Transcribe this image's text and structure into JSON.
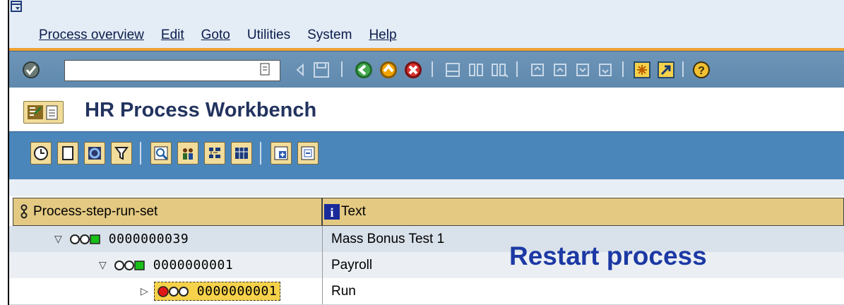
{
  "menu": {
    "items": [
      "Process overview",
      "Edit",
      "Goto",
      "Utilities",
      "System",
      "Help"
    ]
  },
  "toolbar": {
    "command_field_value": "",
    "icons": [
      "enter-icon",
      "dropdown-icon",
      "back-arrow-icon",
      "save-icon",
      "back-icon",
      "exit-icon",
      "cancel-icon",
      "print-icon",
      "find-icon",
      "find-next-icon",
      "first-page-icon",
      "prev-page-icon",
      "next-page-icon",
      "last-page-icon",
      "new-session-icon",
      "shortcut-icon",
      "help-icon"
    ]
  },
  "page": {
    "title": "HR Process Workbench"
  },
  "app_toolbar": {
    "icons": [
      "execute-icon",
      "new-icon",
      "refresh-icon",
      "filter-icon",
      "detail-icon",
      "people-icon",
      "hierarchy-icon",
      "layout-icon",
      "expand-icon",
      "collapse-icon"
    ]
  },
  "table": {
    "headers": [
      "Process-step-run-set",
      "Text"
    ],
    "rows": [
      {
        "level": 0,
        "expander": "▽",
        "status": "green",
        "id": "0000000039",
        "text": "Mass Bonus Test 1"
      },
      {
        "level": 1,
        "expander": "▽",
        "status": "green",
        "id": "0000000001",
        "text": "Payroll"
      },
      {
        "level": 2,
        "expander": "▷",
        "status": "red",
        "id": "0000000001",
        "text": "Run"
      }
    ]
  },
  "callout": "Restart process",
  "colors": {
    "menu_bg": "#e4ecf6",
    "toolbar_bg": "#6d95b8",
    "app_toolbar_bg": "#4b86bb",
    "header_bg": "#e3c982",
    "selected_row": "#f5d24a",
    "callout": "#1c39a4"
  }
}
